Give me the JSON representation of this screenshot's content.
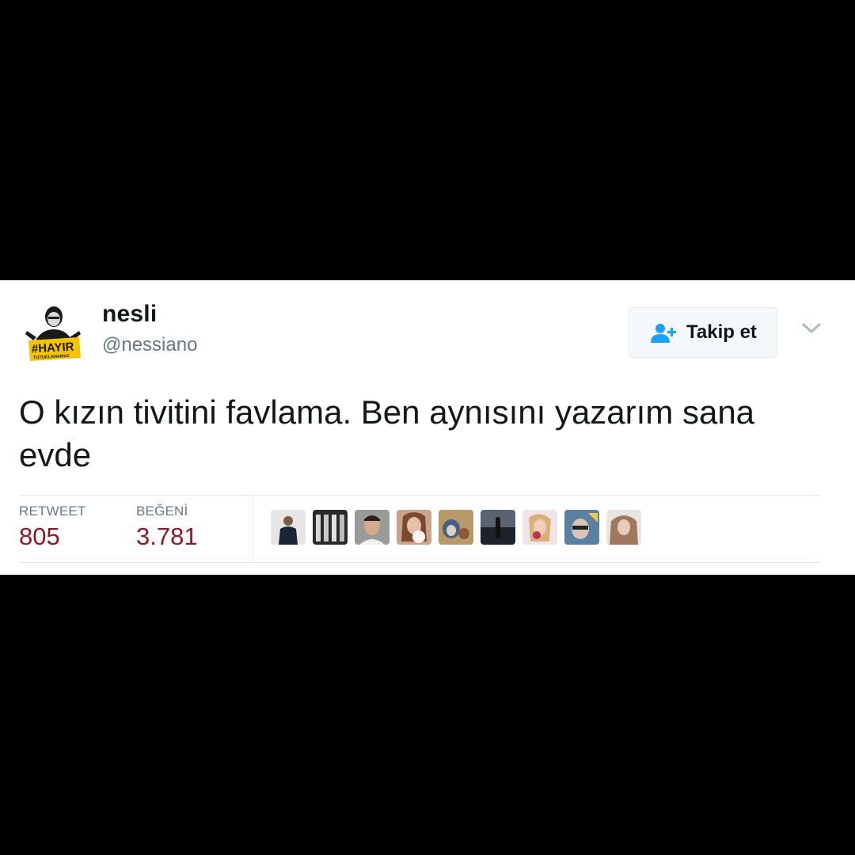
{
  "tweet": {
    "author": {
      "name": "nesli",
      "handle": "@nessiano",
      "avatar_badge_text": "#HAYIR",
      "avatar_badge_subtext": "TUTUKLANAMAZ"
    },
    "follow_button": {
      "label": "Takip et",
      "icon": "add-user-icon"
    },
    "menu_icon": "chevron-down-icon",
    "text": "O kızın tivitini favlama. Ben aynısını yazarım sana evde",
    "stats": {
      "retweets_label": "RETWEET",
      "retweets_value": "805",
      "likes_label": "BEĞENİ",
      "likes_value": "3.781"
    },
    "likers_count_shown": 9
  },
  "colors": {
    "background": "#000000",
    "card": "#ffffff",
    "stat_value": "#8b1a28",
    "muted": "#657786",
    "follow_icon": "#1da1f2",
    "badge_yellow": "#f5c400"
  }
}
